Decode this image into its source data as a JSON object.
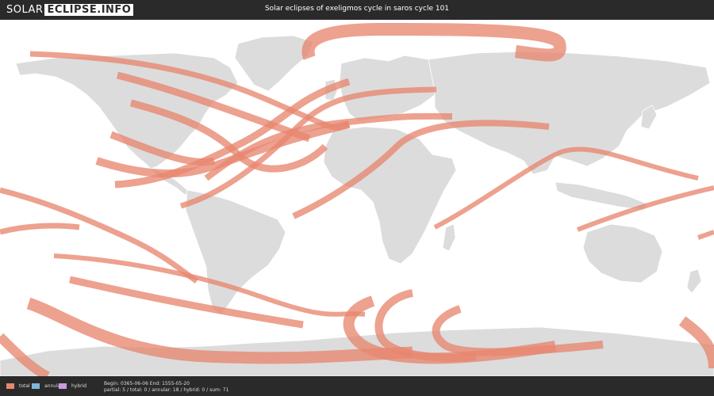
{
  "header": {
    "logo_part1": "SOLAR",
    "logo_part2": "ECLIPSE.INFO",
    "title": "Solar eclipses of exeligmos cycle in saros cycle 101"
  },
  "colors": {
    "total": "#e8876f",
    "annular": "#7fb7d8",
    "hybrid": "#c79be0",
    "land": "#dcdcdc",
    "ocean": "#ffffff"
  },
  "legend": [
    {
      "key": "total",
      "label": "total"
    },
    {
      "key": "annular",
      "label": "annular"
    },
    {
      "key": "hybrid",
      "label": "hybrid"
    }
  ],
  "footer": {
    "range": "Begin: 0365-06-06 End: 1555-05-20",
    "counts": "partial: 5 / total: 0 / annular: 18 / hybrid: 0 / sum: 71"
  }
}
